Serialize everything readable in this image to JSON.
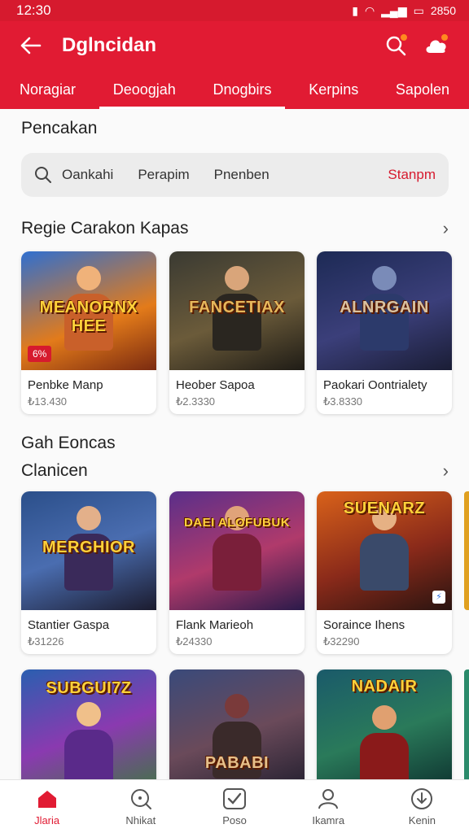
{
  "status": {
    "time": "12:30",
    "battery": "2850"
  },
  "header": {
    "title": "Dglncidan"
  },
  "tabs": [
    "Noragiar",
    "Deoogjah",
    "Dnogbirs",
    "Kerpins",
    "Sapolen"
  ],
  "section_top": "Pencakan",
  "search": {
    "query": "Oankahi",
    "seg1": "Perapim",
    "seg2": "Pnenben",
    "action": "Stanpm"
  },
  "section1": {
    "title": "Regie Carakon Kapas"
  },
  "row1": [
    {
      "logo": "MEANORNX HEE",
      "name": "Penbke Manp",
      "price": "₺13.430",
      "badge": "6%"
    },
    {
      "logo": "FANCETIAX",
      "name": "Heober Sapoa",
      "price": "₺2.3330"
    },
    {
      "logo": "ALNRGAIN",
      "name": "Paokari Oontrialety",
      "price": "₺3.8330"
    }
  ],
  "section2": {
    "title": "Gah Eoncas",
    "subtitle": "Clanicen"
  },
  "row2": [
    {
      "logo": "MERGHIOR",
      "name": "Stantier Gaspa",
      "price": "₺31226"
    },
    {
      "logo": "DAEI ALOFUBUK",
      "name": "Flank Marieoh",
      "price": "₺24330"
    },
    {
      "logo": "SUENARZ",
      "name": "Soraince Ihens",
      "price": "₺32290",
      "mini": "⚡"
    }
  ],
  "row3": [
    {
      "logo": "SUBGUI7Z"
    },
    {
      "logo": "PABABI"
    },
    {
      "logo": "NADAIR"
    }
  ],
  "nav": [
    "Jlaria",
    "Nhikat",
    "Poso",
    "Ikamra",
    "Kenin"
  ],
  "colors": {
    "primary": "#e11b33",
    "status_bar": "#d61a2e",
    "accent_text": "#d61a2e",
    "orange_dot": "#ff8a1f"
  }
}
